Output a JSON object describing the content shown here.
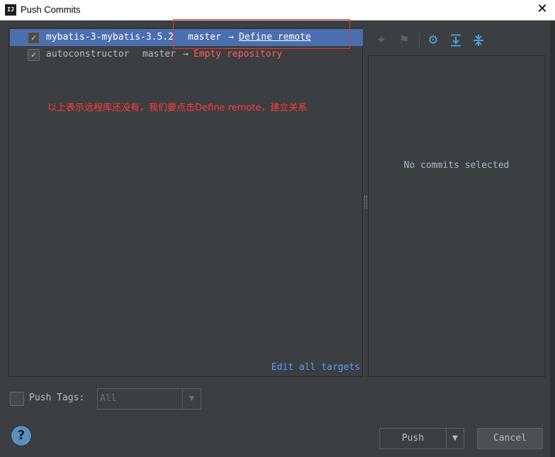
{
  "window": {
    "icon_text": "IJ",
    "title": "Push Commits",
    "close_glyph": "✕"
  },
  "repos": [
    {
      "checked": true,
      "name": "mybatis-3-mybatis-3.5.2",
      "branch": "master",
      "arrow": "→",
      "target": "Define remote"
    },
    {
      "checked": true,
      "name": "autoconstructor",
      "branch": "master",
      "arrow": "→",
      "target": "Empty repository"
    }
  ],
  "annotation": {
    "text": "以上表示远程库还没有，我们要点击Define remote，建立关系",
    "color": "#ff3b3b"
  },
  "edit_all_targets": "Edit all targets",
  "toolbar_icons": [
    "pin-icon",
    "cherry-pick-icon",
    "gear-icon",
    "expand-all-icon",
    "collapse-all-icon"
  ],
  "details": {
    "empty_text": "No commits selected"
  },
  "push_tags": {
    "checked": false,
    "label": "Push Tags:",
    "value": "All"
  },
  "buttons": {
    "help": "?",
    "push": "Push",
    "cancel": "Cancel"
  },
  "colors": {
    "background": "#3c3f41",
    "selection": "#4b6eaf",
    "link": "#589df6",
    "error": "#ff5b5b",
    "accent_icon": "#4a9fd8"
  }
}
